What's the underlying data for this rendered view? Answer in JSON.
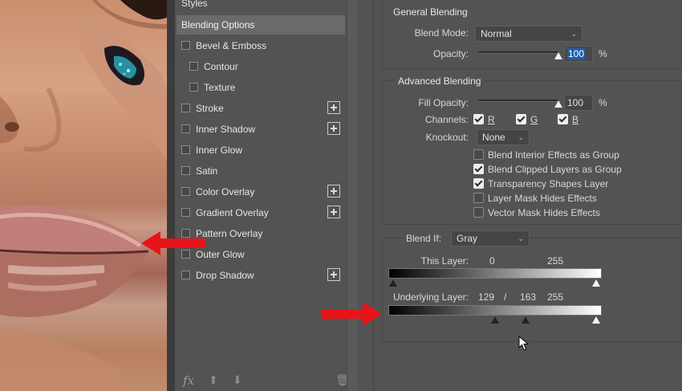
{
  "styles_panel": {
    "header": "Styles",
    "items": [
      {
        "label": "Blending Options",
        "checkbox": false,
        "indent": false,
        "plus": false,
        "active": true
      },
      {
        "label": "Bevel & Emboss",
        "checkbox": true,
        "indent": false,
        "plus": false
      },
      {
        "label": "Contour",
        "checkbox": true,
        "indent": true,
        "plus": false
      },
      {
        "label": "Texture",
        "checkbox": true,
        "indent": true,
        "plus": false
      },
      {
        "label": "Stroke",
        "checkbox": true,
        "indent": false,
        "plus": true
      },
      {
        "label": "Inner Shadow",
        "checkbox": true,
        "indent": false,
        "plus": true
      },
      {
        "label": "Inner Glow",
        "checkbox": true,
        "indent": false,
        "plus": false
      },
      {
        "label": "Satin",
        "checkbox": true,
        "indent": false,
        "plus": false
      },
      {
        "label": "Color Overlay",
        "checkbox": true,
        "indent": false,
        "plus": true
      },
      {
        "label": "Gradient Overlay",
        "checkbox": true,
        "indent": false,
        "plus": true
      },
      {
        "label": "Pattern Overlay",
        "checkbox": true,
        "indent": false,
        "plus": false
      },
      {
        "label": "Outer Glow",
        "checkbox": true,
        "indent": false,
        "plus": false
      },
      {
        "label": "Drop Shadow",
        "checkbox": true,
        "indent": false,
        "plus": true
      }
    ],
    "footer": {
      "fx": "fx",
      "up": "⬆",
      "down": "⬇",
      "trash": "🗑"
    }
  },
  "general_blending": {
    "title": "General Blending",
    "blend_mode_label": "Blend Mode:",
    "blend_mode_value": "Normal",
    "opacity_label": "Opacity:",
    "opacity_value": "100",
    "opacity_unit": "%",
    "opacity_fraction": 1.0
  },
  "advanced_blending": {
    "title": "Advanced Blending",
    "fill_opacity_label": "Fill Opacity:",
    "fill_opacity_value": "100",
    "fill_opacity_unit": "%",
    "fill_opacity_fraction": 1.0,
    "channels_label": "Channels:",
    "channels": [
      {
        "label": "R",
        "checked": true
      },
      {
        "label": "G",
        "checked": true
      },
      {
        "label": "B",
        "checked": true
      }
    ],
    "knockout_label": "Knockout:",
    "knockout_value": "None",
    "options": [
      {
        "label": "Blend Interior Effects as Group",
        "checked": false
      },
      {
        "label": "Blend Clipped Layers as Group",
        "checked": true
      },
      {
        "label": "Transparency Shapes Layer",
        "checked": true
      },
      {
        "label": "Layer Mask Hides Effects",
        "checked": false
      },
      {
        "label": "Vector Mask Hides Effects",
        "checked": false
      }
    ]
  },
  "blend_if": {
    "label": "Blend If:",
    "value": "Gray",
    "this_layer": {
      "label": "This Layer:",
      "black": "0",
      "white": "255"
    },
    "underlying_layer": {
      "label": "Underlying Layer:",
      "black_low": "129",
      "separator": "/",
      "black_high": "163",
      "white": "255"
    }
  }
}
